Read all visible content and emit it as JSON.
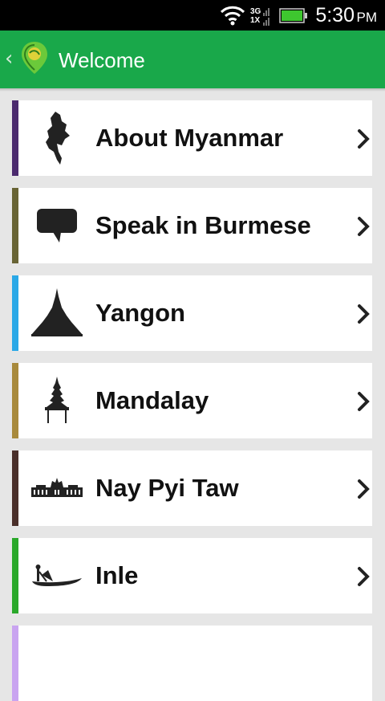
{
  "status_bar": {
    "time": "5:30",
    "ampm": "PM",
    "network_top": "3G",
    "network_bottom": "1X",
    "battery_color": "#3ec72f"
  },
  "header": {
    "title": "Welcome",
    "color": "#19a84a"
  },
  "items": [
    {
      "label": "About Myanmar",
      "accent": "#4b2a6e",
      "icon": "myanmar-map-icon"
    },
    {
      "label": "Speak in Burmese",
      "accent": "#686434",
      "icon": "speech-bubble-icon"
    },
    {
      "label": "Yangon",
      "accent": "#2aa8e7",
      "icon": "pagoda-icon"
    },
    {
      "label": "Mandalay",
      "accent": "#a88a3c",
      "icon": "palace-spire-icon"
    },
    {
      "label": "Nay Pyi Taw",
      "accent": "#4a2f2a",
      "icon": "parliament-building-icon"
    },
    {
      "label": "Inle",
      "accent": "#2aa82a",
      "icon": "fisherman-boat-icon"
    },
    {
      "label": "",
      "accent": "#c9a4f0",
      "icon": ""
    }
  ]
}
